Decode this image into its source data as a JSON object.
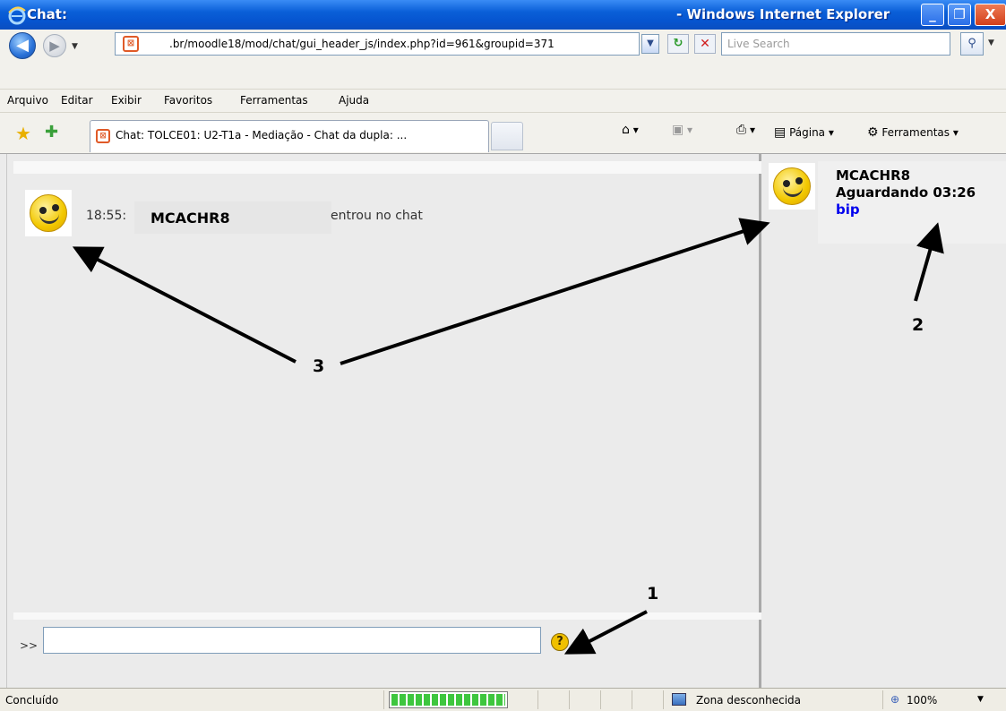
{
  "window": {
    "title_left": "Chat:",
    "title_right": "- Windows Internet Explorer",
    "min_glyph": "_",
    "max_glyph": "❐",
    "close_glyph": "X"
  },
  "addressbar": {
    "url": ".br/moodle18/mod/chat/gui_header_js/index.php?id=961&groupid=371",
    "search_placeholder": "Live Search"
  },
  "menu": {
    "items": [
      "Arquivo",
      "Editar",
      "Exibir",
      "Favoritos",
      "Ferramentas",
      "Ajuda"
    ]
  },
  "tabbar": {
    "tab_title": "Chat: TOLCE01: U2-T1a - Mediação - Chat da dupla: ...",
    "page_label": "Página",
    "tools_label": "Ferramentas"
  },
  "chat": {
    "messages": [
      {
        "time": "18:55:",
        "user": "MCACHR8",
        "text": "entrou no chat"
      }
    ],
    "prompt": ">>",
    "help_glyph": "?"
  },
  "users": [
    {
      "name": "MCACHR8",
      "status": "Aguardando 03:26",
      "beep": "bip"
    }
  ],
  "statusbar": {
    "status": "Concluído",
    "zone": "Zona desconhecida",
    "zoom": "100%",
    "progress": 1.0
  },
  "annotations": {
    "labels": [
      "1",
      "2",
      "3"
    ]
  },
  "icons": [
    "ie-logo-icon",
    "back-arrow-icon",
    "forward-arrow-icon",
    "refresh-icon",
    "stop-icon",
    "search-icon",
    "star-icon",
    "add-favorite-icon",
    "home-icon",
    "feeds-icon",
    "print-icon",
    "page-icon",
    "tools-gear-icon",
    "smiley-avatar-icon",
    "help-icon",
    "zone-icon",
    "zoom-icon"
  ],
  "colors": {
    "titlebar": "#0a5fd8",
    "beep_link": "#0000ee",
    "background": "#ebebeb"
  }
}
